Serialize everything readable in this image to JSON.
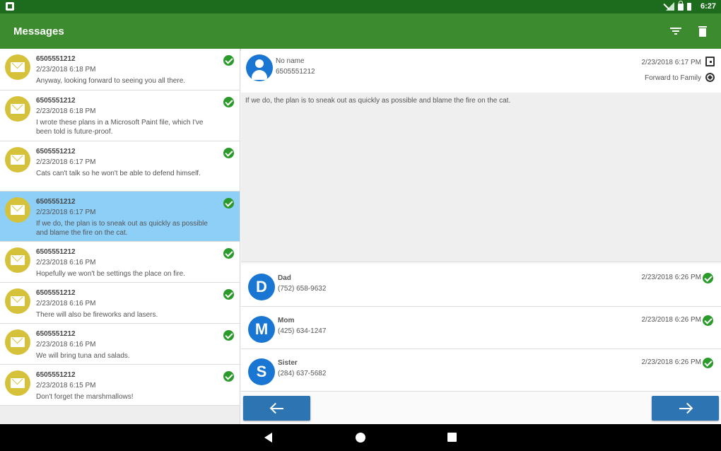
{
  "status_bar": {
    "time": "6:27"
  },
  "app_bar": {
    "title": "Messages"
  },
  "messages": [
    {
      "from": "6505551212",
      "date": "2/23/2018 6:18 PM",
      "text": "Anyway, looking forward to seeing you all there.",
      "selected": false
    },
    {
      "from": "6505551212",
      "date": "2/23/2018 6:18 PM",
      "text": "I wrote these plans in a Microsoft Paint file, which I've been told is future-proof.",
      "selected": false
    },
    {
      "from": "6505551212",
      "date": "2/23/2018 6:17 PM",
      "text": "Cats can't talk so he won't be able to defend himself.",
      "selected": false
    },
    {
      "from": "6505551212",
      "date": "2/23/2018 6:17 PM",
      "text": "If we do, the plan is to sneak out as quickly as possible and blame the fire on the cat.",
      "selected": true
    },
    {
      "from": "6505551212",
      "date": "2/23/2018 6:16 PM",
      "text": "Hopefully we won't be settings the place on fire.",
      "selected": false
    },
    {
      "from": "6505551212",
      "date": "2/23/2018 6:16 PM",
      "text": "There will also be fireworks and lasers.",
      "selected": false
    },
    {
      "from": "6505551212",
      "date": "2/23/2018 6:16 PM",
      "text": "We will bring tuna and salads.",
      "selected": false
    },
    {
      "from": "6505551212",
      "date": "2/23/2018 6:15 PM",
      "text": "Don't forget the marshmallows!",
      "selected": false
    }
  ],
  "detail": {
    "name": "No name",
    "number": "6505551212",
    "date": "2/23/2018 6:17 PM",
    "forward_label": "Forward to Family",
    "body": "If we do, the plan is to sneak out as quickly as possible and blame the fire on the cat."
  },
  "recipients": [
    {
      "initial": "D",
      "name": "Dad",
      "phone": "(752) 658-9632",
      "date": "2/23/2018 6:26 PM"
    },
    {
      "initial": "M",
      "name": "Mom",
      "phone": "(425) 634-1247",
      "date": "2/23/2018 6:26 PM"
    },
    {
      "initial": "S",
      "name": "Sister",
      "phone": "(284) 637-5682",
      "date": "2/23/2018 6:26 PM"
    }
  ],
  "colors": {
    "status_bar": "#1d6b1d",
    "app_bar": "#3c8c2f",
    "selected_row": "#8dcff7",
    "envelope_circle": "#d6c23a",
    "avatar": "#1976d2",
    "check": "#2a9a2a",
    "nav_button": "#2d74b3"
  }
}
